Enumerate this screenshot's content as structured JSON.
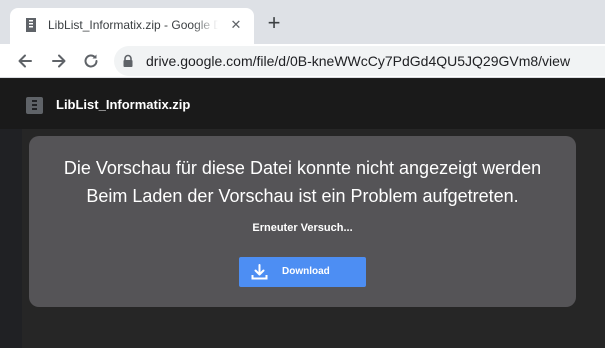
{
  "tab": {
    "title": "LibList_Informatix.zip - Google Drive",
    "close_glyph": "✕",
    "favicon_icon": "zip-file-icon"
  },
  "new_tab_glyph": "+",
  "toolbar": {
    "back_icon": "arrow-left-icon",
    "forward_icon": "arrow-right-icon",
    "reload_icon": "reload-icon",
    "lock_icon": "lock-icon",
    "url": "drive.google.com/file/d/0B-kneWWcCy7PdGd4QU5JQ29GVm8/view"
  },
  "viewer": {
    "file_name": "LibList_Informatix.zip",
    "file_icon": "zip-file-icon",
    "preview_error_line1": "Die Vorschau für diese Datei konnte nicht angezeigt werden",
    "preview_error_line2": "Beim Laden der Vorschau ist ein Problem aufgetreten.",
    "retry_label": "Erneuter Versuch...",
    "download_label": "Download",
    "download_icon": "download-icon"
  },
  "colors": {
    "tabstrip_bg": "#dee1e6",
    "viewer_bg": "#202124",
    "card_bg": "#555457",
    "download_button_bg": "#4d8ef3"
  }
}
